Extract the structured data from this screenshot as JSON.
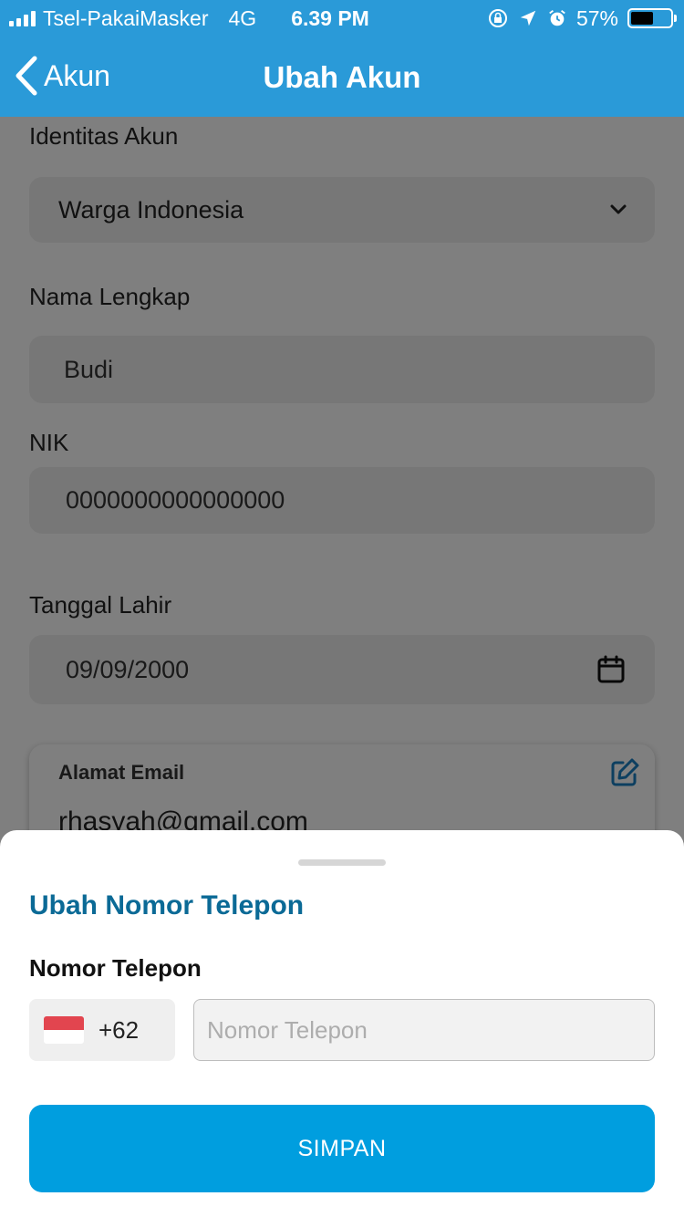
{
  "status_bar": {
    "carrier": "Tsel-PakaiMasker",
    "network": "4G",
    "time": "6.39 PM",
    "battery": "57%",
    "battery_level": 0.57
  },
  "nav": {
    "back_label": "Akun",
    "title": "Ubah Akun"
  },
  "form": {
    "identity": {
      "label": "Identitas Akun",
      "value": "Warga Indonesia"
    },
    "full_name": {
      "label": "Nama Lengkap",
      "value": "Budi"
    },
    "nik": {
      "label": "NIK",
      "value": "0000000000000000"
    },
    "birth_date": {
      "label": "Tanggal Lahir",
      "value": "09/09/2000"
    },
    "email": {
      "label": "Alamat Email",
      "value": "rhasyah@gmail.com"
    }
  },
  "sheet": {
    "title": "Ubah Nomor Telepon",
    "phone_label": "Nomor Telepon",
    "country_code": "+62",
    "phone_placeholder": "Nomor Telepon",
    "phone_value": "",
    "save_label": "SIMPAN"
  },
  "colors": {
    "header": "#2a9ad8",
    "accent": "#0b6a96",
    "button": "#009edf",
    "flag_red": "#e2454f"
  }
}
